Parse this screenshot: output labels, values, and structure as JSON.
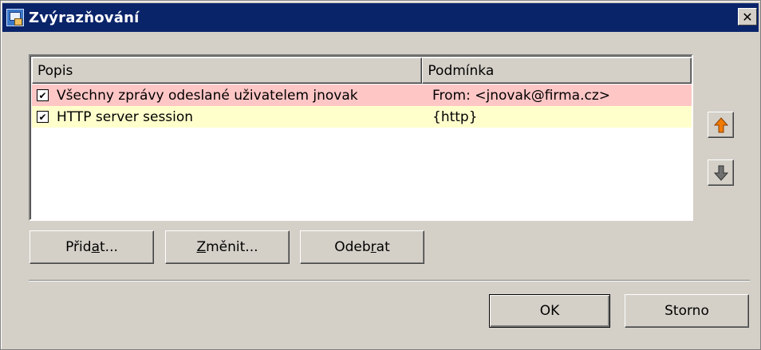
{
  "window": {
    "title": "Zvýrazňování",
    "close_glyph": "✕"
  },
  "list": {
    "columns": [
      "Popis",
      "Podmínka"
    ],
    "rows": [
      {
        "checked": true,
        "description": "Všechny zprávy odeslané uživatelem jnovak",
        "condition": "From: <jnovak@firma.cz>",
        "color": "#ffc6c6"
      },
      {
        "checked": true,
        "description": "HTTP server session",
        "condition": "{http}",
        "color": "#ffffcc"
      }
    ],
    "check_glyph": "✔"
  },
  "side_buttons": {
    "up_icon": "arrow-up-icon",
    "down_icon": "arrow-down-icon",
    "up_color": "#f07a00",
    "down_color": "#707070"
  },
  "actions": {
    "add_pre": "Přid",
    "add_key": "a",
    "add_post": "t...",
    "edit_pre": "",
    "edit_key": "Z",
    "edit_post": "měnit...",
    "remove_pre": "Odeb",
    "remove_key": "r",
    "remove_post": "at"
  },
  "footer": {
    "ok_label": "OK",
    "cancel_label": "Storno"
  }
}
